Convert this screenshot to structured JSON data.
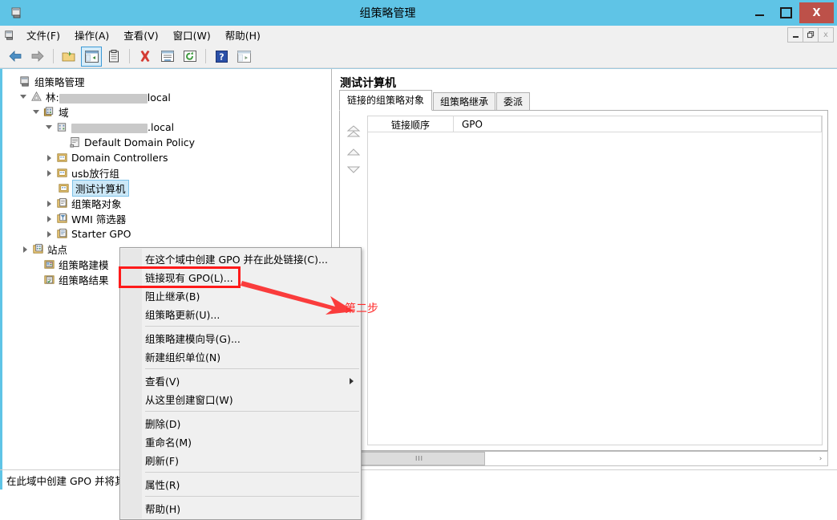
{
  "window": {
    "title": "组策略管理",
    "icon": "console-icon",
    "controls": {
      "minimize": "minimize-icon",
      "maximize": "maximize-icon",
      "close": "X"
    }
  },
  "menubar": {
    "icon": "console-icon",
    "items": [
      {
        "label": "文件(F)",
        "name": "menu-file"
      },
      {
        "label": "操作(A)",
        "name": "menu-action"
      },
      {
        "label": "查看(V)",
        "name": "menu-view"
      },
      {
        "label": "窗口(W)",
        "name": "menu-window"
      },
      {
        "label": "帮助(H)",
        "name": "menu-help"
      }
    ],
    "mdi": {
      "minimize": "mdi-minimize-icon",
      "restore": "mdi-restore-icon",
      "close": "x"
    }
  },
  "toolbar": {
    "buttons": [
      {
        "name": "back-icon",
        "label": ""
      },
      {
        "name": "forward-icon",
        "label": ""
      },
      {
        "name": "up-folder-icon",
        "label": ""
      },
      {
        "name": "show-hide-tree-icon",
        "label": ""
      },
      {
        "name": "properties-clipboard-icon",
        "label": ""
      },
      {
        "name": "delete-icon",
        "label": ""
      },
      {
        "name": "report-icon",
        "label": ""
      },
      {
        "name": "refresh-icon",
        "label": ""
      },
      {
        "name": "help-icon",
        "label": ""
      },
      {
        "name": "new-window-icon",
        "label": ""
      }
    ]
  },
  "tree": {
    "nodes": [
      {
        "label": "组策略管理",
        "icon": "console-icon",
        "indent": 0,
        "expander": "none",
        "selected": false,
        "redact": 0
      },
      {
        "label": "林:",
        "suffix": "local",
        "icon": "forest-icon",
        "indent": 1,
        "expander": "expanded",
        "selected": false,
        "redact": 110
      },
      {
        "label": "域",
        "icon": "domains-icon",
        "indent": 2,
        "expander": "expanded",
        "selected": false,
        "redact": 0
      },
      {
        "label": "",
        "suffix": ".local",
        "icon": "domain-icon",
        "indent": 3,
        "expander": "expanded",
        "selected": false,
        "redact": 95
      },
      {
        "label": "Default Domain Policy",
        "icon": "gpo-link-icon",
        "indent": 4,
        "expander": "none",
        "selected": false,
        "redact": 0
      },
      {
        "label": "Domain Controllers",
        "icon": "ou-icon",
        "indent": 4,
        "expander": "collapsed",
        "selected": false,
        "redact": 0
      },
      {
        "label": "usb放行组",
        "icon": "ou-icon",
        "indent": 4,
        "expander": "collapsed",
        "selected": false,
        "redact": 0
      },
      {
        "label": "测试计算机",
        "icon": "ou-icon",
        "indent": 4,
        "expander": "none",
        "selected": true,
        "redact": 0
      },
      {
        "label": "组策略对象",
        "icon": "gpo-folder-icon",
        "indent": 4,
        "expander": "collapsed",
        "selected": false,
        "redact": 0
      },
      {
        "label": "WMI 筛选器",
        "icon": "wmi-filter-icon",
        "indent": 4,
        "expander": "collapsed",
        "selected": false,
        "redact": 0
      },
      {
        "label": "Starter GPO",
        "icon": "starter-gpo-icon",
        "indent": 4,
        "expander": "collapsed",
        "selected": false,
        "redact": 0
      },
      {
        "label": "站点",
        "icon": "sites-icon",
        "indent": 2,
        "expander": "collapsed",
        "selected": false,
        "redact": 0
      },
      {
        "label": "组策略建模",
        "icon": "modeling-icon",
        "indent": 2,
        "expander": "none",
        "selected": false,
        "redact": 0
      },
      {
        "label": "组策略结果",
        "icon": "results-icon",
        "indent": 2,
        "expander": "none",
        "selected": false,
        "redact": 0
      }
    ]
  },
  "right_pane": {
    "title": "测试计算机",
    "tabs": [
      {
        "label": "链接的组策略对象",
        "selected": true
      },
      {
        "label": "组策略继承",
        "selected": false
      },
      {
        "label": "委派",
        "selected": false
      }
    ],
    "columns": [
      {
        "label": "链接顺序"
      },
      {
        "label": "GPO"
      }
    ],
    "rows": [],
    "order_buttons": [
      {
        "name": "move-top-button"
      },
      {
        "name": "move-up-button"
      },
      {
        "name": "move-down-button"
      }
    ],
    "hscroll": {
      "left_arrow": "‹",
      "right_arrow": "›",
      "thumb_grip": "III"
    }
  },
  "context_menu": {
    "items": [
      {
        "label": "在这个域中创建 GPO 并在此处链接(C)...",
        "highlighted": false,
        "submenu": false
      },
      {
        "label": "链接现有 GPO(L)...",
        "highlighted": true,
        "submenu": false
      },
      {
        "label": "阻止继承(B)",
        "highlighted": false,
        "submenu": false
      },
      {
        "label": "组策略更新(U)...",
        "highlighted": false,
        "submenu": false
      },
      {
        "separator": true
      },
      {
        "label": "组策略建模向导(G)...",
        "highlighted": false,
        "submenu": false
      },
      {
        "label": "新建组织单位(N)",
        "highlighted": false,
        "submenu": false
      },
      {
        "separator": true
      },
      {
        "label": "查看(V)",
        "highlighted": false,
        "submenu": true
      },
      {
        "label": "从这里创建窗口(W)",
        "highlighted": false,
        "submenu": false
      },
      {
        "separator": true
      },
      {
        "label": "删除(D)",
        "highlighted": false,
        "submenu": false
      },
      {
        "label": "重命名(M)",
        "highlighted": false,
        "submenu": false
      },
      {
        "label": "刷新(F)",
        "highlighted": false,
        "submenu": false
      },
      {
        "separator": true
      },
      {
        "label": "属性(R)",
        "highlighted": false,
        "submenu": false
      },
      {
        "separator": true
      },
      {
        "label": "帮助(H)",
        "highlighted": false,
        "submenu": false
      }
    ]
  },
  "annotation": {
    "text": "第二步",
    "color": "#ff2a2a",
    "arrow": "red-arrow-pointing-right"
  },
  "statusbar": {
    "text": "在此域中创建 GPO 并将其链接到此容器"
  },
  "colors": {
    "titlebar": "#5fc4e6",
    "close_button": "#bd5149",
    "selection": "#cce8f7",
    "annotation_red": "#ff2a2a",
    "chrome": "#f0f0f0"
  }
}
